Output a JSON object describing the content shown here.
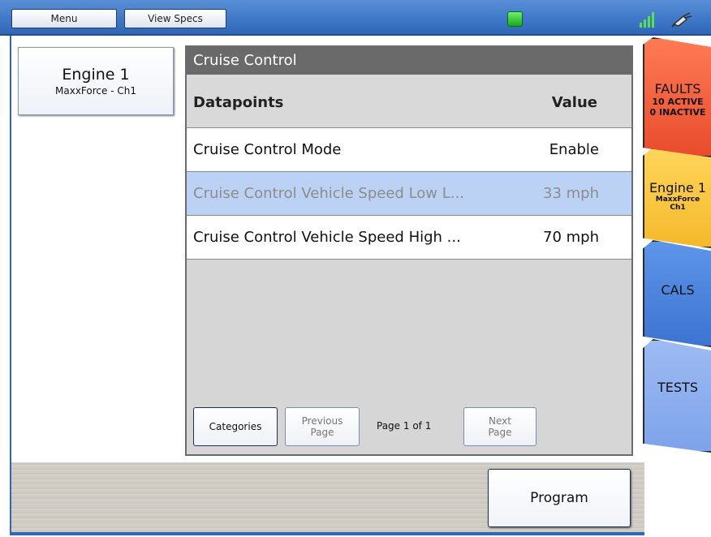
{
  "topbar": {
    "menu_label": "Menu",
    "view_specs_label": "View Specs",
    "status_color": "#2ecc40"
  },
  "left": {
    "engine_title": "Engine 1",
    "engine_subtitle": "MaxxForce - Ch1"
  },
  "panel": {
    "title": "Cruise Control",
    "col_datapoints": "Datapoints",
    "col_value": "Value",
    "rows": [
      {
        "name": "Cruise Control Mode",
        "value": "Enable"
      },
      {
        "name": "Cruise Control Vehicle Speed Low L...",
        "value": "33 mph"
      },
      {
        "name": "Cruise Control Vehicle Speed High ...",
        "value": "70 mph"
      }
    ],
    "categories_label": "Categories",
    "prev_line1": "Previous",
    "prev_line2": "Page",
    "page_label": "Page 1 of 1",
    "next_line1": "Next",
    "next_line2": "Page"
  },
  "bottom": {
    "program_label": "Program"
  },
  "tabs": {
    "faults_title": "FAULTS",
    "faults_active": "10 ACTIVE",
    "faults_inactive": "0 INACTIVE",
    "engine_title": "Engine 1",
    "engine_sub1": "MaxxForce",
    "engine_sub2": "Ch1",
    "cals": "CALS",
    "tests": "TESTS"
  },
  "colors": {
    "topbar": "#3f79c8",
    "faults_tab": "#e84c2c",
    "engine_tab": "#f4b92b",
    "cals_tab": "#3d74d2",
    "tests_tab": "#7ea3ea",
    "selected_row": "#bcd2f4"
  }
}
